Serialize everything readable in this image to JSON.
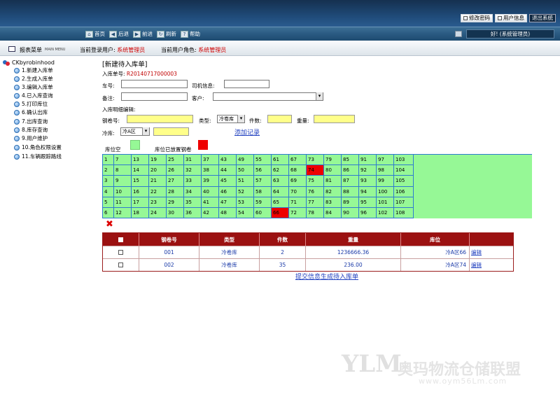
{
  "header": {
    "buttons": [
      "修改密码",
      "用户信息",
      "退出系统"
    ]
  },
  "nav": {
    "items": [
      {
        "icon": "home-icon",
        "label": "首页",
        "glyph": "⌂"
      },
      {
        "icon": "back-icon",
        "label": "后退",
        "glyph": "◀"
      },
      {
        "icon": "forward-icon",
        "label": "前进",
        "glyph": "▶"
      },
      {
        "icon": "refresh-icon",
        "label": "刷新",
        "glyph": "↻"
      },
      {
        "icon": "help-icon",
        "label": "帮助",
        "glyph": "?"
      }
    ],
    "welcome": "好! (系统管理员)"
  },
  "statusbar": {
    "menu_label": "报表菜单",
    "menu_en": "MAIN MENU",
    "user_label": "当前登录用户:",
    "user_value": "系统管理员",
    "role_label": "当前用户角色:",
    "role_value": "系统管理员"
  },
  "sidebar": {
    "root": "CKbyrobinhood",
    "items": [
      "1.新建入库单",
      "2.生成入库单",
      "3.编辑入库单",
      "4.已入库查询",
      "5.打印库位",
      "6.确认出库",
      "7.出库查询",
      "8.库存查询",
      "9.用户维护",
      "10.角色权限设置",
      "11.车辆跟踪路线"
    ]
  },
  "form": {
    "heading": "[新建待入库单]",
    "order_label": "入库单号:",
    "order_no": "R20140717000003",
    "car_label": "车号:",
    "driver_label": "司机信息:",
    "remark_label": "备注:",
    "customer_label": "客户:",
    "detail_label": "入库明细编辑:",
    "coil_label": "钢卷号:",
    "type_label": "类型:",
    "type_value": "冷卷库",
    "count_label": "件数:",
    "weight_label": "重量:",
    "cold_label": "冷库:",
    "cold_value": "冷A区",
    "add_record": "添加记录",
    "legend_empty": "库位空",
    "legend_full": "库位已放置钢卷"
  },
  "grid": {
    "rows": 6,
    "cols": 18,
    "cells": [
      [
        "1",
        "7",
        "13",
        "19",
        "25",
        "31",
        "37",
        "43",
        "49",
        "55",
        "61",
        "67",
        "73",
        "79",
        "85",
        "91",
        "97",
        "103"
      ],
      [
        "2",
        "8",
        "14",
        "20",
        "26",
        "32",
        "38",
        "44",
        "50",
        "56",
        "62",
        "68",
        "74",
        "80",
        "86",
        "92",
        "98",
        "104"
      ],
      [
        "3",
        "9",
        "15",
        "21",
        "27",
        "33",
        "39",
        "45",
        "51",
        "57",
        "63",
        "69",
        "75",
        "81",
        "87",
        "93",
        "99",
        "105"
      ],
      [
        "4",
        "10",
        "16",
        "22",
        "28",
        "34",
        "40",
        "46",
        "52",
        "58",
        "64",
        "70",
        "76",
        "82",
        "88",
        "94",
        "100",
        "106"
      ],
      [
        "5",
        "11",
        "17",
        "23",
        "29",
        "35",
        "41",
        "47",
        "53",
        "59",
        "65",
        "71",
        "77",
        "83",
        "89",
        "95",
        "101",
        "107"
      ],
      [
        "6",
        "12",
        "18",
        "24",
        "30",
        "36",
        "42",
        "48",
        "54",
        "60",
        "66",
        "72",
        "78",
        "84",
        "90",
        "96",
        "102",
        "108"
      ]
    ],
    "occupied": [
      "74",
      "66"
    ]
  },
  "table": {
    "headers": [
      "钢卷号",
      "类型",
      "件数",
      "重量",
      "库位"
    ],
    "rows": [
      {
        "coil": "001",
        "type": "冷卷库",
        "count": "2",
        "weight": "1236666.36",
        "location": "冷A区66",
        "edit": "编辑"
      },
      {
        "coil": "002",
        "type": "冷卷库",
        "count": "35",
        "weight": "236.00",
        "location": "冷A区74",
        "edit": "编辑"
      }
    ]
  },
  "submit": "提交信息生成待入库单",
  "watermark": {
    "logo": "YLM",
    "text": "奥玛物流仓储联盟",
    "url": "www.oym56Lm.com"
  },
  "colors": {
    "empty": "#96f896",
    "full": "#ee0000",
    "accent": "#9b1111"
  }
}
